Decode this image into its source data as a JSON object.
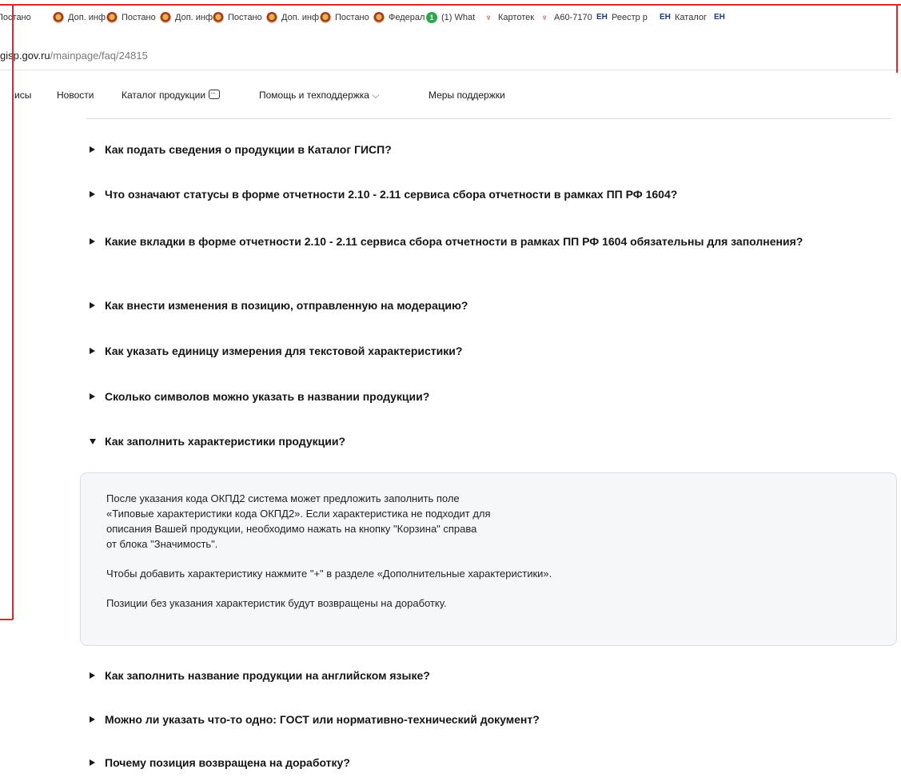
{
  "bookmarks": [
    {
      "label": "Постано",
      "icon": "eagle-icon"
    },
    {
      "label": "Доп. инф",
      "icon": "eagle-icon"
    },
    {
      "label": "Постано",
      "icon": "eagle-icon"
    },
    {
      "label": "Доп. инф",
      "icon": "eagle-icon"
    },
    {
      "label": "Постано",
      "icon": "eagle-icon"
    },
    {
      "label": "Доп. инф",
      "icon": "eagle-icon"
    },
    {
      "label": "Постано",
      "icon": "eagle-icon"
    },
    {
      "label": "Федерал",
      "icon": "eagle-icon"
    },
    {
      "label": "(1) What",
      "icon": "whatsapp-icon"
    },
    {
      "label": "Картотек",
      "icon": "crest-icon"
    },
    {
      "label": "А60-7170",
      "icon": "crest-icon"
    },
    {
      "label": "Реестр р",
      "icon": "hh-icon"
    },
    {
      "label": "Каталог",
      "icon": "hh-icon"
    }
  ],
  "address": {
    "host": "gisp.gov.ru",
    "path": "/mainpage/faq/24815"
  },
  "nav": {
    "partial": "исы",
    "news": "Новости",
    "catalog": "Каталог продукции",
    "help": "Помощь и техподдержка",
    "help_chevron": "⌵",
    "support": "Меры поддержки"
  },
  "faq": [
    {
      "question": "Как подать сведения о продукции в Каталог ГИСП?",
      "open": false
    },
    {
      "question": "Что означают статусы в форме отчетности 2.10 - 2.11 сервиса сбора отчетности в рамках ПП РФ 1604?",
      "open": false
    },
    {
      "question": "Какие вкладки в форме отчетности 2.10 - 2.11 сервиса сбора отчетности в рамках ПП РФ 1604 обязательны для заполнения?",
      "open": false
    },
    {
      "question": "Как внести изменения в позицию, отправленную на модерацию?",
      "open": false
    },
    {
      "question": "Как указать единицу измерения для текстовой характеристики?",
      "open": false
    },
    {
      "question": "Сколько символов можно указать в названии продукции?",
      "open": false
    },
    {
      "question": "Как заполнить характеристики продукции?",
      "open": true
    },
    {
      "question": "Как заполнить название продукции на английском языке?",
      "open": false
    },
    {
      "question": "Можно ли указать что-то одно: ГОСТ или нормативно-технический документ?",
      "open": false
    },
    {
      "question": "Почему позиция возвращена на доработку?",
      "open": false
    }
  ],
  "answer": {
    "p1_l1": "После указания кода ОКПД2 система может предложить заполнить поле",
    "p1_l2": "«Типовые характеристики кода ОКПД2». Если характеристика не подходит для",
    "p1_l3": "описания Вашей продукции, необходимо нажать на кнопку \"Корзина\" справа",
    "p1_l4": "от блока \"Значимость\".",
    "p2": "Чтобы добавить характеристику нажмите \"+\" в разделе «Дополнительные характеристики».",
    "p3": "Позиции без указания характеристик будут возвращены на доработку."
  },
  "colors": {
    "annotation_frame": "#e0262a",
    "answer_bg": "#f6f7f9"
  }
}
